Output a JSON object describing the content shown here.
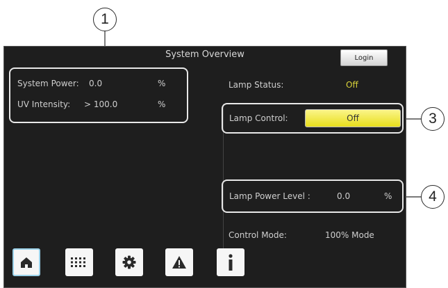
{
  "callouts": [
    "1",
    "3",
    "4"
  ],
  "header": {
    "title": "System Overview",
    "login_label": "Login"
  },
  "status_panel": {
    "system_power_label": "System Power:",
    "system_power_value": "0.0",
    "system_power_unit": "%",
    "uv_intensity_label": "UV Intensity:",
    "uv_intensity_value": "> 100.0",
    "uv_intensity_unit": "%"
  },
  "lamp": {
    "status_label": "Lamp Status:",
    "status_value": "Off",
    "control_label": "Lamp Control:",
    "control_button": "Off",
    "power_level_label": "Lamp Power Level :",
    "power_level_value": "0.0",
    "power_level_unit": "%",
    "control_mode_label": "Control Mode:",
    "control_mode_value": "100% Mode"
  },
  "nav": [
    {
      "id": "home",
      "icon": "home-icon"
    },
    {
      "id": "grid",
      "icon": "keypad-icon"
    },
    {
      "id": "settings",
      "icon": "gear-icon"
    },
    {
      "id": "alarms",
      "icon": "warning-icon"
    },
    {
      "id": "info",
      "icon": "info-icon"
    }
  ],
  "colors": {
    "background": "#1e1e1e",
    "lamp_button": "#f1e94a",
    "off_text": "#d9d33a",
    "active_nav": "#9bd2ea"
  }
}
